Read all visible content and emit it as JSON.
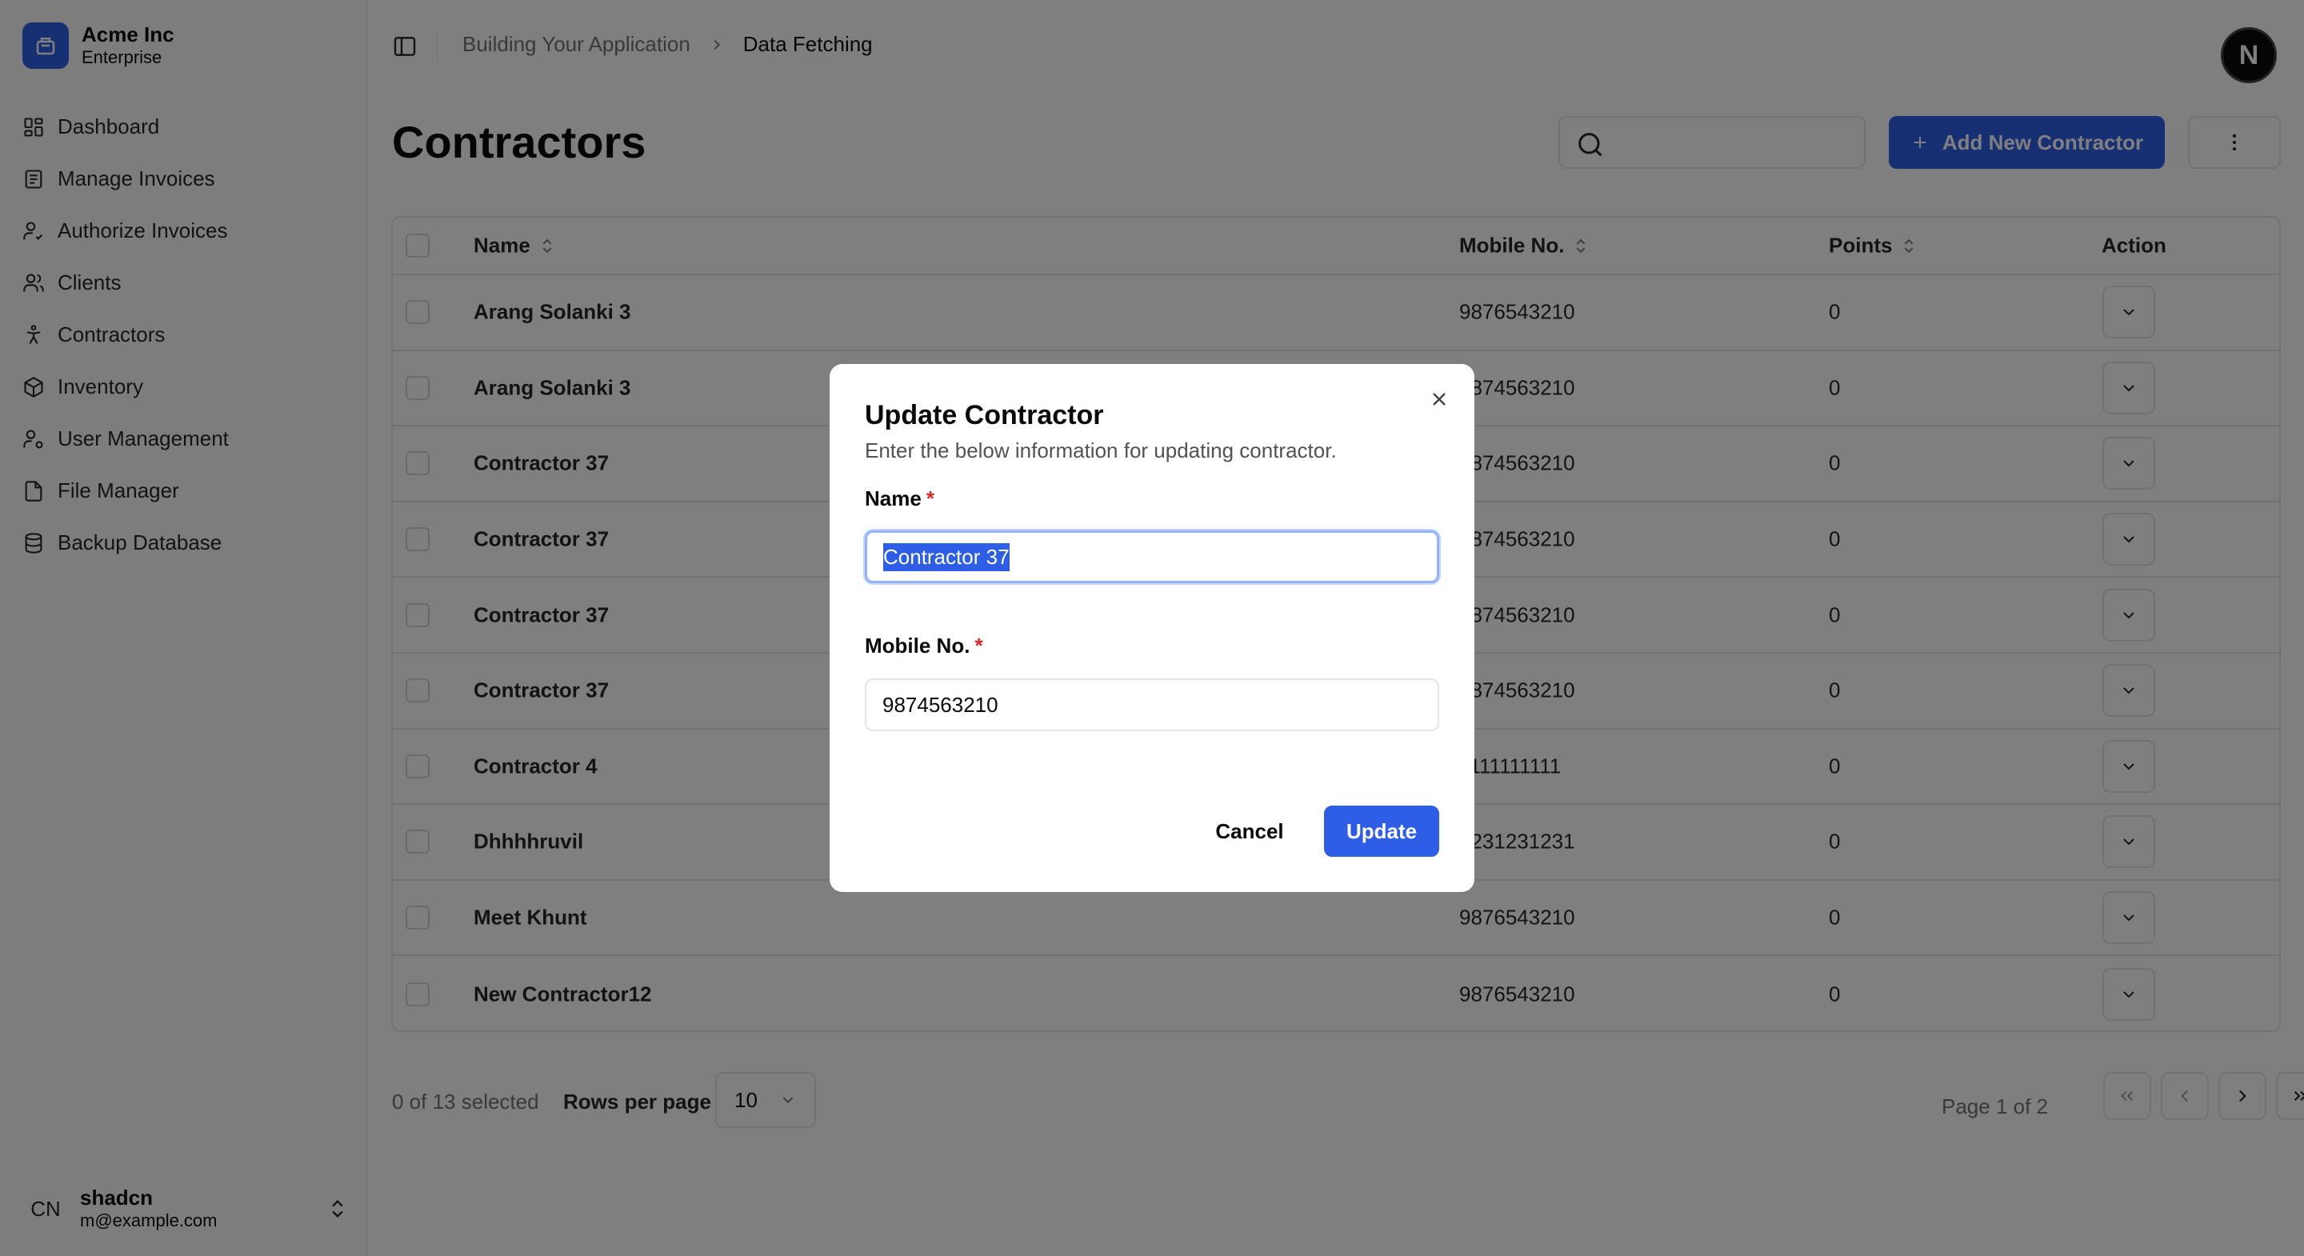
{
  "brand": {
    "name": "Acme Inc",
    "plan": "Enterprise"
  },
  "nav": {
    "items": [
      {
        "label": "Dashboard",
        "icon": "grid-icon"
      },
      {
        "label": "Manage Invoices",
        "icon": "document-icon"
      },
      {
        "label": "Authorize Invoices",
        "icon": "user-check-icon"
      },
      {
        "label": "Clients",
        "icon": "users-icon"
      },
      {
        "label": "Contractors",
        "icon": "person-icon"
      },
      {
        "label": "Inventory",
        "icon": "package-icon"
      },
      {
        "label": "User Management",
        "icon": "user-cog-icon"
      },
      {
        "label": "File Manager",
        "icon": "file-icon"
      },
      {
        "label": "Backup Database",
        "icon": "database-icon"
      }
    ]
  },
  "user": {
    "initials": "CN",
    "name": "shadcn",
    "email": "m@example.com"
  },
  "breadcrumb": {
    "parent": "Building Your Application",
    "current": "Data Fetching"
  },
  "top_avatar": "N",
  "page": {
    "title": "Contractors",
    "add_button": "Add New Contractor",
    "search_placeholder": ""
  },
  "table": {
    "headers": {
      "name": "Name",
      "mobile": "Mobile No.",
      "points": "Points",
      "action": "Action"
    },
    "rows": [
      {
        "name": "Arang Solanki 3",
        "mobile": "9876543210",
        "points": "0"
      },
      {
        "name": "Arang Solanki 3",
        "mobile": "9874563210",
        "points": "0"
      },
      {
        "name": "Contractor 37",
        "mobile": "9874563210",
        "points": "0"
      },
      {
        "name": "Contractor 37",
        "mobile": "9874563210",
        "points": "0"
      },
      {
        "name": "Contractor 37",
        "mobile": "9874563210",
        "points": "0"
      },
      {
        "name": "Contractor 37",
        "mobile": "9874563210",
        "points": "0"
      },
      {
        "name": "Contractor 4",
        "mobile": "1111111111",
        "points": "0"
      },
      {
        "name": "Dhhhhruvil",
        "mobile": "1231231231",
        "points": "0"
      },
      {
        "name": "Meet Khunt",
        "mobile": "9876543210",
        "points": "0"
      },
      {
        "name": "New Contractor12",
        "mobile": "9876543210",
        "points": "0"
      }
    ]
  },
  "footer": {
    "selected": "0 of 13 selected",
    "rows_per_page_label": "Rows per page",
    "rows_per_page_value": "10",
    "page_info": "Page 1 of 2"
  },
  "modal": {
    "title": "Update Contractor",
    "description": "Enter the below information for updating contractor.",
    "name_label": "Name",
    "name_value": "Contractor 37",
    "mobile_label": "Mobile No.",
    "mobile_value": "9874563210",
    "required_mark": "*",
    "cancel": "Cancel",
    "update": "Update"
  },
  "colors": {
    "accent": "#2f5ee6",
    "required": "#dc2626",
    "overlay": "rgba(0,0,0,0.5)"
  }
}
